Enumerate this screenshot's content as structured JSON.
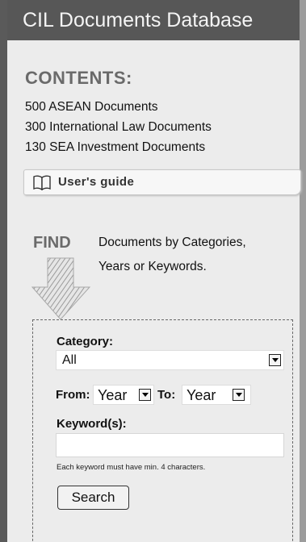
{
  "header": {
    "title": "CIL Documents Database"
  },
  "contents": {
    "title": "CONTENTS:",
    "items": [
      "500 ASEAN Documents",
      "300 International Law Documents",
      "130 SEA Investment Documents"
    ]
  },
  "guide": {
    "label": "User's guide",
    "icon": "book-icon"
  },
  "find": {
    "title": "FIND",
    "line1": "Documents by Categories,",
    "line2": "Years or Keywords.",
    "icon": "down-arrow-icon"
  },
  "form": {
    "category_label": "Category:",
    "category_value": "All",
    "from_label": "From:",
    "from_value": "Year",
    "to_label": "To:",
    "to_value": "Year",
    "keyword_label": "Keyword(s):",
    "keyword_value": "",
    "keyword_hint": "Each keyword must have min. 4 characters.",
    "search_label": "Search"
  },
  "colors": {
    "header_bg": "#575757",
    "panel_bg": "#ececec",
    "heading_gray": "#6a6a6a"
  }
}
